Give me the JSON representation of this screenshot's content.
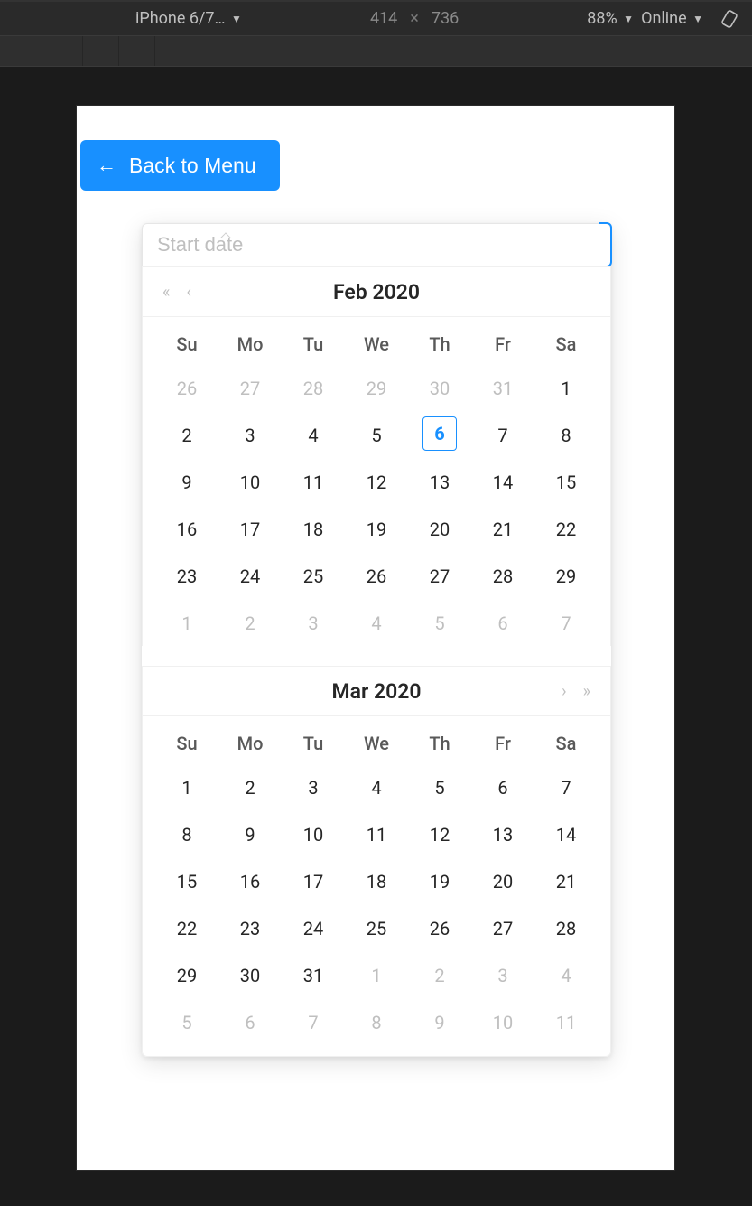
{
  "devtools": {
    "device_label": "iPhone 6/7…",
    "width": "414",
    "height": "736",
    "zoom": "88%",
    "throttle": "Online"
  },
  "app": {
    "back_label": "Back to Menu",
    "input_placeholder": "Start date"
  },
  "days_of_week": [
    "Su",
    "Mo",
    "Tu",
    "We",
    "Th",
    "Fr",
    "Sa"
  ],
  "panel1": {
    "title": "Feb 2020",
    "cells": [
      {
        "d": "26",
        "other": true
      },
      {
        "d": "27",
        "other": true
      },
      {
        "d": "28",
        "other": true
      },
      {
        "d": "29",
        "other": true
      },
      {
        "d": "30",
        "other": true
      },
      {
        "d": "31",
        "other": true
      },
      {
        "d": "1"
      },
      {
        "d": "2"
      },
      {
        "d": "3"
      },
      {
        "d": "4"
      },
      {
        "d": "5"
      },
      {
        "d": "6",
        "today": true
      },
      {
        "d": "7"
      },
      {
        "d": "8"
      },
      {
        "d": "9"
      },
      {
        "d": "10"
      },
      {
        "d": "11"
      },
      {
        "d": "12"
      },
      {
        "d": "13"
      },
      {
        "d": "14"
      },
      {
        "d": "15"
      },
      {
        "d": "16"
      },
      {
        "d": "17"
      },
      {
        "d": "18"
      },
      {
        "d": "19"
      },
      {
        "d": "20"
      },
      {
        "d": "21"
      },
      {
        "d": "22"
      },
      {
        "d": "23"
      },
      {
        "d": "24"
      },
      {
        "d": "25"
      },
      {
        "d": "26"
      },
      {
        "d": "27"
      },
      {
        "d": "28"
      },
      {
        "d": "29"
      },
      {
        "d": "1",
        "other": true
      },
      {
        "d": "2",
        "other": true
      },
      {
        "d": "3",
        "other": true
      },
      {
        "d": "4",
        "other": true
      },
      {
        "d": "5",
        "other": true
      },
      {
        "d": "6",
        "other": true
      },
      {
        "d": "7",
        "other": true
      }
    ]
  },
  "panel2": {
    "title": "Mar 2020",
    "cells": [
      {
        "d": "1"
      },
      {
        "d": "2"
      },
      {
        "d": "3"
      },
      {
        "d": "4"
      },
      {
        "d": "5"
      },
      {
        "d": "6"
      },
      {
        "d": "7"
      },
      {
        "d": "8"
      },
      {
        "d": "9"
      },
      {
        "d": "10"
      },
      {
        "d": "11"
      },
      {
        "d": "12"
      },
      {
        "d": "13"
      },
      {
        "d": "14"
      },
      {
        "d": "15"
      },
      {
        "d": "16"
      },
      {
        "d": "17"
      },
      {
        "d": "18"
      },
      {
        "d": "19"
      },
      {
        "d": "20"
      },
      {
        "d": "21"
      },
      {
        "d": "22"
      },
      {
        "d": "23"
      },
      {
        "d": "24"
      },
      {
        "d": "25"
      },
      {
        "d": "26"
      },
      {
        "d": "27"
      },
      {
        "d": "28"
      },
      {
        "d": "29"
      },
      {
        "d": "30"
      },
      {
        "d": "31"
      },
      {
        "d": "1",
        "other": true
      },
      {
        "d": "2",
        "other": true
      },
      {
        "d": "3",
        "other": true
      },
      {
        "d": "4",
        "other": true
      },
      {
        "d": "5",
        "other": true
      },
      {
        "d": "6",
        "other": true
      },
      {
        "d": "7",
        "other": true
      },
      {
        "d": "8",
        "other": true
      },
      {
        "d": "9",
        "other": true
      },
      {
        "d": "10",
        "other": true
      },
      {
        "d": "11",
        "other": true
      }
    ]
  },
  "glyphs": {
    "tri_down": "▼",
    "dbl_left": "«",
    "single_left": "‹",
    "single_right": "›",
    "dbl_right": "»",
    "x": "×",
    "arrow_left": "←"
  }
}
